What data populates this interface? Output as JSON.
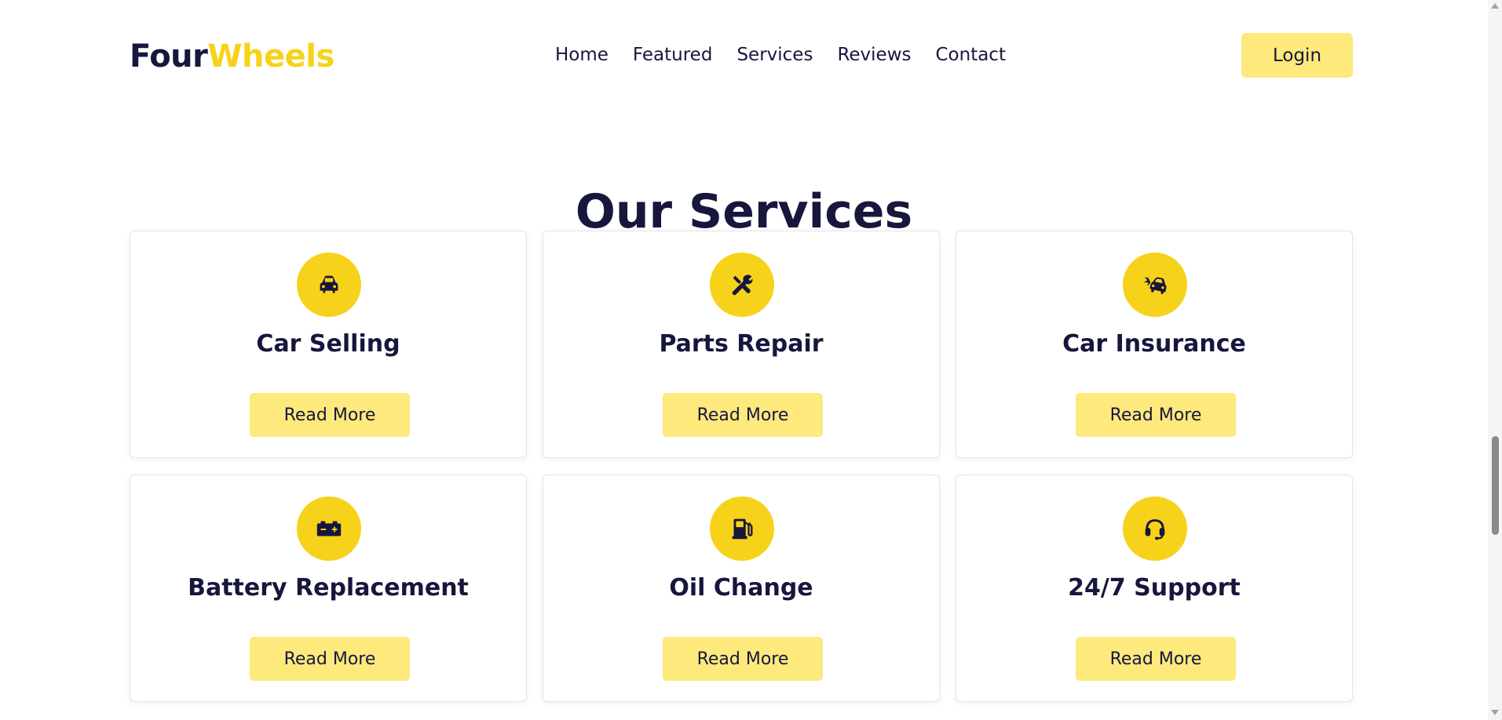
{
  "brand": {
    "part_a": "Four",
    "part_b": "Wheels",
    "accent": "#f7d21a",
    "dark": "#17163d"
  },
  "nav": {
    "items": [
      {
        "label": "Home"
      },
      {
        "label": "Featured"
      },
      {
        "label": "Services"
      },
      {
        "label": "Reviews"
      },
      {
        "label": "Contact"
      }
    ],
    "login_label": "Login"
  },
  "section": {
    "title_a": "Our",
    "title_b": "Services"
  },
  "services": [
    {
      "title": "Car Selling",
      "icon": "car-icon",
      "button": "Read More"
    },
    {
      "title": "Parts Repair",
      "icon": "tools-icon",
      "button": "Read More"
    },
    {
      "title": "Car Insurance",
      "icon": "car-crash-icon",
      "button": "Read More"
    },
    {
      "title": "Battery Replacement",
      "icon": "battery-icon",
      "button": "Read More"
    },
    {
      "title": "Oil Change",
      "icon": "fuel-pump-icon",
      "button": "Read More"
    },
    {
      "title": "24/7 Support",
      "icon": "headset-icon",
      "button": "Read More"
    }
  ]
}
